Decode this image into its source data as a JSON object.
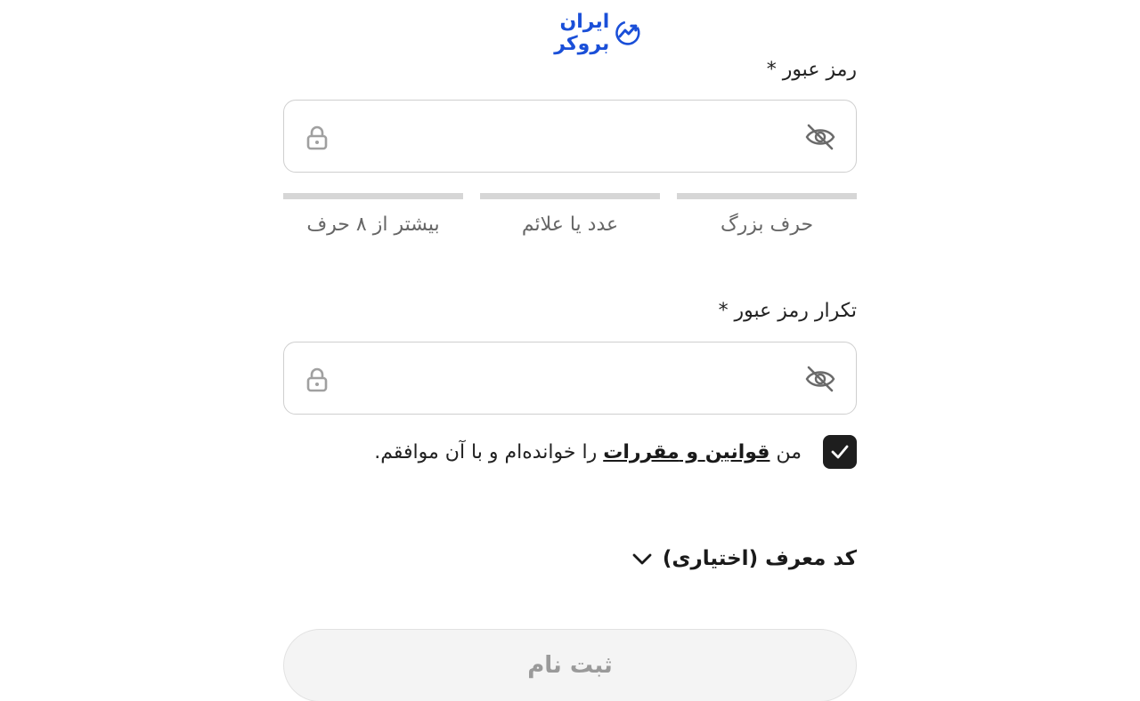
{
  "brand": {
    "name": "ایران بروکر",
    "color": "#1a4fd8",
    "mark_icon": "chart-trend-icon"
  },
  "password": {
    "label": "رمز عبور *",
    "value": "",
    "lock_icon": "lock-icon",
    "toggle_icon": "eye-slash-icon"
  },
  "strength": {
    "rules": [
      {
        "label": "حرف بزرگ",
        "met": false
      },
      {
        "label": "عدد یا علائم",
        "met": false
      },
      {
        "label": "بیشتر از ۸ حرف",
        "met": false
      }
    ],
    "inactive_color": "#d6d6d6"
  },
  "confirm_password": {
    "label": "تکرار رمز عبور *",
    "value": "",
    "lock_icon": "lock-icon",
    "toggle_icon": "eye-slash-icon"
  },
  "terms": {
    "checked": true,
    "prefix": "من ",
    "link1": "قوانین",
    "joiner": " و ",
    "link2": "مقررات",
    "suffix": " را خوانده‌ام و با آن موافقم."
  },
  "referral": {
    "label": "کد معرف (اختیاری)",
    "icon": "chevron-down-icon"
  },
  "submit": {
    "label": "ثبت نام",
    "enabled": false
  }
}
